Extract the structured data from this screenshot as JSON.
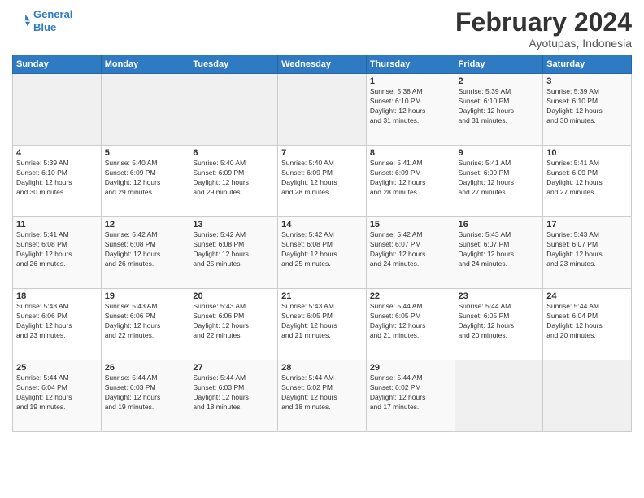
{
  "header": {
    "logo_line1": "General",
    "logo_line2": "Blue",
    "month": "February 2024",
    "location": "Ayotupas, Indonesia"
  },
  "days_of_week": [
    "Sunday",
    "Monday",
    "Tuesday",
    "Wednesday",
    "Thursday",
    "Friday",
    "Saturday"
  ],
  "weeks": [
    [
      {
        "day": "",
        "info": ""
      },
      {
        "day": "",
        "info": ""
      },
      {
        "day": "",
        "info": ""
      },
      {
        "day": "",
        "info": ""
      },
      {
        "day": "1",
        "info": "Sunrise: 5:38 AM\nSunset: 6:10 PM\nDaylight: 12 hours\nand 31 minutes."
      },
      {
        "day": "2",
        "info": "Sunrise: 5:39 AM\nSunset: 6:10 PM\nDaylight: 12 hours\nand 31 minutes."
      },
      {
        "day": "3",
        "info": "Sunrise: 5:39 AM\nSunset: 6:10 PM\nDaylight: 12 hours\nand 30 minutes."
      }
    ],
    [
      {
        "day": "4",
        "info": "Sunrise: 5:39 AM\nSunset: 6:10 PM\nDaylight: 12 hours\nand 30 minutes."
      },
      {
        "day": "5",
        "info": "Sunrise: 5:40 AM\nSunset: 6:09 PM\nDaylight: 12 hours\nand 29 minutes."
      },
      {
        "day": "6",
        "info": "Sunrise: 5:40 AM\nSunset: 6:09 PM\nDaylight: 12 hours\nand 29 minutes."
      },
      {
        "day": "7",
        "info": "Sunrise: 5:40 AM\nSunset: 6:09 PM\nDaylight: 12 hours\nand 28 minutes."
      },
      {
        "day": "8",
        "info": "Sunrise: 5:41 AM\nSunset: 6:09 PM\nDaylight: 12 hours\nand 28 minutes."
      },
      {
        "day": "9",
        "info": "Sunrise: 5:41 AM\nSunset: 6:09 PM\nDaylight: 12 hours\nand 27 minutes."
      },
      {
        "day": "10",
        "info": "Sunrise: 5:41 AM\nSunset: 6:09 PM\nDaylight: 12 hours\nand 27 minutes."
      }
    ],
    [
      {
        "day": "11",
        "info": "Sunrise: 5:41 AM\nSunset: 6:08 PM\nDaylight: 12 hours\nand 26 minutes."
      },
      {
        "day": "12",
        "info": "Sunrise: 5:42 AM\nSunset: 6:08 PM\nDaylight: 12 hours\nand 26 minutes."
      },
      {
        "day": "13",
        "info": "Sunrise: 5:42 AM\nSunset: 6:08 PM\nDaylight: 12 hours\nand 25 minutes."
      },
      {
        "day": "14",
        "info": "Sunrise: 5:42 AM\nSunset: 6:08 PM\nDaylight: 12 hours\nand 25 minutes."
      },
      {
        "day": "15",
        "info": "Sunrise: 5:42 AM\nSunset: 6:07 PM\nDaylight: 12 hours\nand 24 minutes."
      },
      {
        "day": "16",
        "info": "Sunrise: 5:43 AM\nSunset: 6:07 PM\nDaylight: 12 hours\nand 24 minutes."
      },
      {
        "day": "17",
        "info": "Sunrise: 5:43 AM\nSunset: 6:07 PM\nDaylight: 12 hours\nand 23 minutes."
      }
    ],
    [
      {
        "day": "18",
        "info": "Sunrise: 5:43 AM\nSunset: 6:06 PM\nDaylight: 12 hours\nand 23 minutes."
      },
      {
        "day": "19",
        "info": "Sunrise: 5:43 AM\nSunset: 6:06 PM\nDaylight: 12 hours\nand 22 minutes."
      },
      {
        "day": "20",
        "info": "Sunrise: 5:43 AM\nSunset: 6:06 PM\nDaylight: 12 hours\nand 22 minutes."
      },
      {
        "day": "21",
        "info": "Sunrise: 5:43 AM\nSunset: 6:05 PM\nDaylight: 12 hours\nand 21 minutes."
      },
      {
        "day": "22",
        "info": "Sunrise: 5:44 AM\nSunset: 6:05 PM\nDaylight: 12 hours\nand 21 minutes."
      },
      {
        "day": "23",
        "info": "Sunrise: 5:44 AM\nSunset: 6:05 PM\nDaylight: 12 hours\nand 20 minutes."
      },
      {
        "day": "24",
        "info": "Sunrise: 5:44 AM\nSunset: 6:04 PM\nDaylight: 12 hours\nand 20 minutes."
      }
    ],
    [
      {
        "day": "25",
        "info": "Sunrise: 5:44 AM\nSunset: 6:04 PM\nDaylight: 12 hours\nand 19 minutes."
      },
      {
        "day": "26",
        "info": "Sunrise: 5:44 AM\nSunset: 6:03 PM\nDaylight: 12 hours\nand 19 minutes."
      },
      {
        "day": "27",
        "info": "Sunrise: 5:44 AM\nSunset: 6:03 PM\nDaylight: 12 hours\nand 18 minutes."
      },
      {
        "day": "28",
        "info": "Sunrise: 5:44 AM\nSunset: 6:02 PM\nDaylight: 12 hours\nand 18 minutes."
      },
      {
        "day": "29",
        "info": "Sunrise: 5:44 AM\nSunset: 6:02 PM\nDaylight: 12 hours\nand 17 minutes."
      },
      {
        "day": "",
        "info": ""
      },
      {
        "day": "",
        "info": ""
      }
    ]
  ]
}
